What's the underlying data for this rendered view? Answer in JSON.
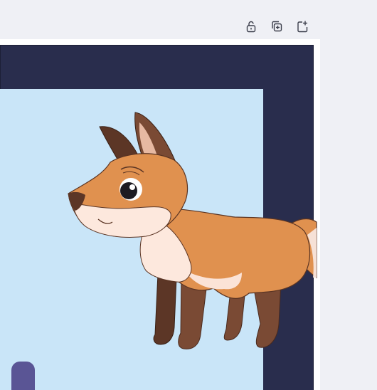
{
  "toolbar": {
    "buttons": [
      {
        "name": "lock-icon",
        "tooltip": ""
      },
      {
        "name": "duplicate-icon",
        "tooltip": ""
      },
      {
        "name": "add-page-icon",
        "tooltip": ""
      }
    ]
  },
  "canvas": {
    "background_color": "#292d4d",
    "panel_color": "#c9e5f8",
    "post_color": "#5a5595",
    "fox_body_color": "#e0914f",
    "fox_dark_color": "#7a4a34"
  }
}
